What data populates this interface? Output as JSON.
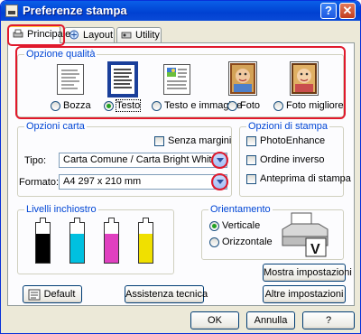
{
  "window": {
    "title": "Preferenze stampa",
    "help_glyph": "?",
    "close_glyph": "✕"
  },
  "tabs": [
    {
      "label": "Principale",
      "icon": "printer-icon",
      "active": true
    },
    {
      "label": "Layout",
      "icon": "layout-icon",
      "active": false
    },
    {
      "label": "Utility",
      "icon": "utility-icon",
      "active": false
    }
  ],
  "quality": {
    "title": "Opzione qualità",
    "options": [
      {
        "label": "Bozza",
        "selected": false
      },
      {
        "label": "Testo",
        "selected": true
      },
      {
        "label": "Testo e immagine",
        "selected": false
      },
      {
        "label": "Foto",
        "selected": false
      },
      {
        "label": "Foto migliore",
        "selected": false
      }
    ]
  },
  "paper": {
    "title": "Opzioni carta",
    "borderless": "Senza margini",
    "type_label": "Tipo:",
    "type_value": "Carta Comune / Carta Bright White",
    "size_label": "Formato:",
    "size_value": "A4 297 x 210 mm"
  },
  "print_options": {
    "title": "Opzioni di stampa",
    "items": [
      {
        "label": "PhotoEnhance",
        "checked": false
      },
      {
        "label": "Ordine inverso",
        "checked": false
      },
      {
        "label": "Anteprima di stampa",
        "checked": false
      }
    ]
  },
  "ink": {
    "title": "Livelli inchiostro",
    "cartridges": [
      {
        "color": "#000000",
        "level": 0.72
      },
      {
        "color": "#00c0e0",
        "level": 0.72
      },
      {
        "color": "#e040c0",
        "level": 0.72
      },
      {
        "color": "#f0e000",
        "level": 0.72
      }
    ]
  },
  "orientation": {
    "title": "Orientamento",
    "options": [
      {
        "label": "Verticale",
        "selected": true
      },
      {
        "label": "Orizzontale",
        "selected": false
      }
    ]
  },
  "buttons": {
    "show_settings": "Mostra impostazioni",
    "default": "Default",
    "support": "Assistenza tecnica",
    "other_settings": "Altre impostazioni",
    "ok": "OK",
    "cancel": "Annulla",
    "help": "?"
  }
}
